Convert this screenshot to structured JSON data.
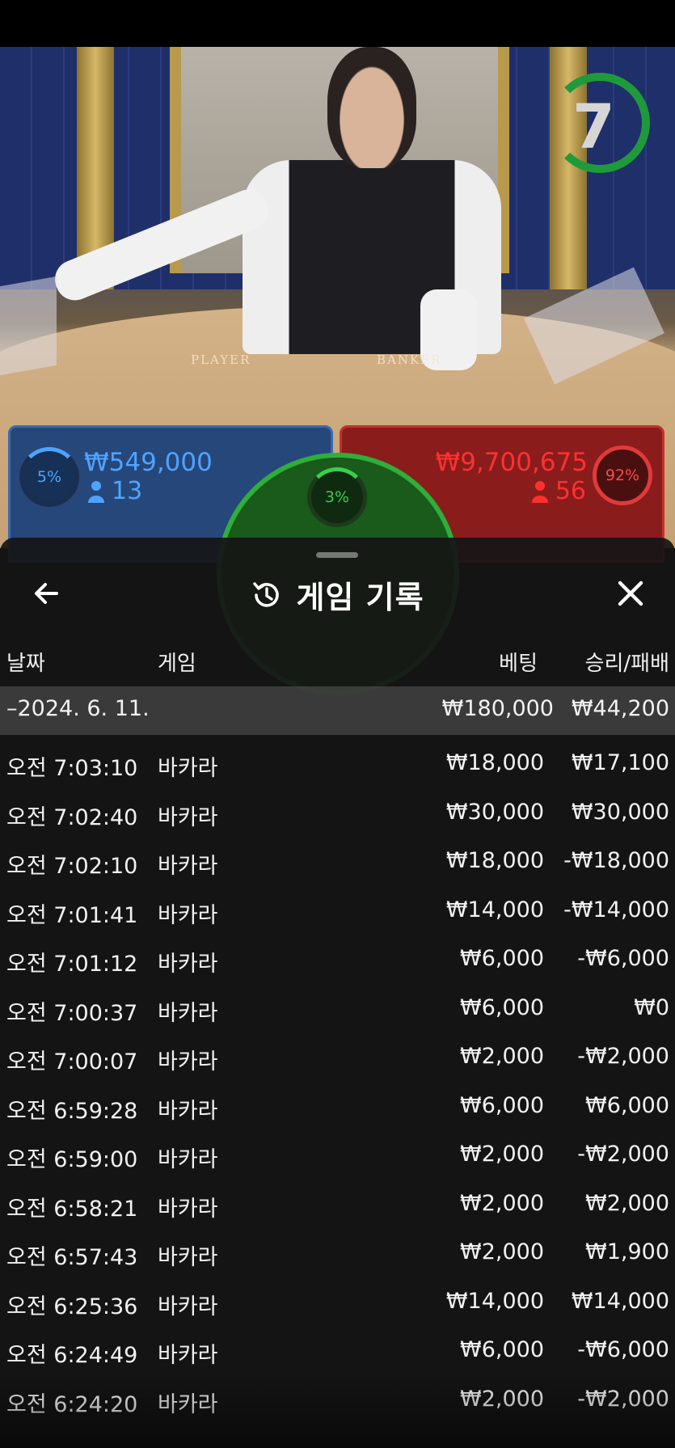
{
  "timer": {
    "value": "7"
  },
  "table_labels": {
    "player": "PLAYER",
    "banker": "BANKER"
  },
  "bets": {
    "player": {
      "percent": "5%",
      "amount": "₩549,000",
      "players": "13",
      "color": "#4fa3ff"
    },
    "banker": {
      "percent": "92%",
      "amount": "₩9,700,675",
      "players": "56",
      "color": "#ff4a4a"
    },
    "tie": {
      "percent": "3%",
      "color": "#37d04a"
    }
  },
  "sheet": {
    "title": "게임 기록",
    "icons": {
      "back": "arrow-left-icon",
      "history": "history-icon",
      "close": "close-icon"
    },
    "columns": {
      "date": "날짜",
      "game": "게임",
      "bet": "베팅",
      "result": "승리/패배"
    },
    "summary": {
      "date": "–2024. 6. 11.",
      "bet": "₩180,000",
      "result": "₩44,200"
    },
    "rows": [
      {
        "time": "오전 7:03:10",
        "game": "바카라",
        "bet": "₩18,000",
        "result": "₩17,100"
      },
      {
        "time": "오전 7:02:40",
        "game": "바카라",
        "bet": "₩30,000",
        "result": "₩30,000"
      },
      {
        "time": "오전 7:02:10",
        "game": "바카라",
        "bet": "₩18,000",
        "result": "-₩18,000"
      },
      {
        "time": "오전 7:01:41",
        "game": "바카라",
        "bet": "₩14,000",
        "result": "-₩14,000"
      },
      {
        "time": "오전 7:01:12",
        "game": "바카라",
        "bet": "₩6,000",
        "result": "-₩6,000"
      },
      {
        "time": "오전 7:00:37",
        "game": "바카라",
        "bet": "₩6,000",
        "result": "₩0"
      },
      {
        "time": "오전 7:00:07",
        "game": "바카라",
        "bet": "₩2,000",
        "result": "-₩2,000"
      },
      {
        "time": "오전 6:59:28",
        "game": "바카라",
        "bet": "₩6,000",
        "result": "₩6,000"
      },
      {
        "time": "오전 6:59:00",
        "game": "바카라",
        "bet": "₩2,000",
        "result": "-₩2,000"
      },
      {
        "time": "오전 6:58:21",
        "game": "바카라",
        "bet": "₩2,000",
        "result": "₩2,000"
      },
      {
        "time": "오전 6:57:43",
        "game": "바카라",
        "bet": "₩2,000",
        "result": "₩1,900"
      },
      {
        "time": "오전 6:25:36",
        "game": "바카라",
        "bet": "₩14,000",
        "result": "₩14,000"
      },
      {
        "time": "오전 6:24:49",
        "game": "바카라",
        "bet": "₩6,000",
        "result": "-₩6,000"
      },
      {
        "time": "오전 6:24:20",
        "game": "바카라",
        "bet": "₩2,000",
        "result": "-₩2,000"
      }
    ]
  }
}
